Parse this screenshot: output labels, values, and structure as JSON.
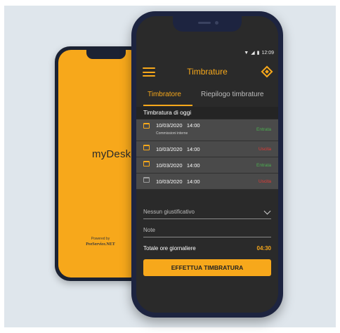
{
  "splash": {
    "logo": "myDesk",
    "powered_by": "Powered by",
    "brand": "PeeService.NET"
  },
  "status_bar": {
    "time": "12:09",
    "wifi_icon": "wifi-icon",
    "signal_icon": "signal-icon",
    "battery_icon": "battery-icon"
  },
  "app_bar": {
    "title": "Timbrature",
    "menu_icon": "hamburger-menu-icon",
    "action_icon": "diamond-icon"
  },
  "tabs": [
    {
      "label": "Timbratore",
      "active": true
    },
    {
      "label": "Riepilogo timbrature",
      "active": false
    }
  ],
  "section_title": "Timbratura di oggi",
  "entries": [
    {
      "date": "10/03/2020",
      "time": "14:00",
      "note": "Commissioni interne",
      "type": "Entrata"
    },
    {
      "date": "10/03/2020",
      "time": "14:00",
      "note": "",
      "type": "Uscita"
    },
    {
      "date": "10/03/2020",
      "time": "14:00",
      "note": "",
      "type": "Entrata"
    },
    {
      "date": "10/03/2020",
      "time": "14:00",
      "note": "",
      "type": "Uscita"
    }
  ],
  "justification": {
    "selected": "Nessun giustificativo"
  },
  "notes": {
    "placeholder": "Note"
  },
  "total": {
    "label": "Totale ore giornaliere",
    "value": "04:30"
  },
  "submit_label": "EFFETTUA TIMBRATURA",
  "colors": {
    "accent": "#f7a81b",
    "entrata": "#4caf50",
    "uscita": "#e53935",
    "screen_bg": "#2a2a2a"
  }
}
